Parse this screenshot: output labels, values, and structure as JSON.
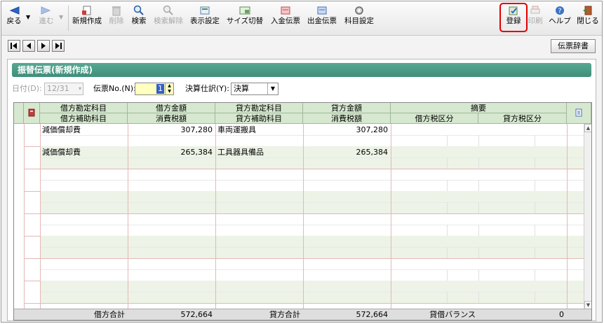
{
  "toolbar": {
    "back": "戻る",
    "forward": "進む",
    "new": "新規作成",
    "delete": "削除",
    "search": "検索",
    "search_clear": "検索解除",
    "display_settings": "表示設定",
    "size_toggle": "サイズ切替",
    "deposit_slip": "入金伝票",
    "withdrawal_slip": "出金伝票",
    "account_settings": "科目設定",
    "register": "登録",
    "print": "印刷",
    "help": "ヘルプ",
    "close": "閉じる"
  },
  "nav": {
    "dictionary_button": "伝票辞書"
  },
  "panel_title": "振替伝票(新規作成)",
  "form": {
    "date_label": "日付(D):",
    "date_value": "12/31",
    "slip_no_label": "伝票No.(N):",
    "slip_no_value": "1",
    "closing_label": "決算仕訳(Y):",
    "closing_value": "決算"
  },
  "grid": {
    "headers_top": [
      "借方勘定科目",
      "借方金額",
      "貸方勘定科目",
      "貸方金額",
      "摘要"
    ],
    "headers_bottom": [
      "借方補助科目",
      "消費税額",
      "貸方補助科目",
      "消費税額",
      "借方税区分",
      "貸方税区分"
    ],
    "rows": [
      {
        "debit_account": "減価償却費",
        "debit_amount": "307,280",
        "credit_account": "車両運搬具",
        "credit_amount": "307,280"
      },
      {
        "debit_account": "減価償却費",
        "debit_amount": "265,384",
        "credit_account": "工具器具備品",
        "credit_amount": "265,384"
      }
    ],
    "footer": {
      "debit_total_label": "借方合計",
      "debit_total": "572,664",
      "credit_total_label": "貸方合計",
      "credit_total": "572,664",
      "balance_label": "貸借バランス",
      "balance": "0"
    }
  },
  "colors": {
    "title_bar": "#4a9b85",
    "header_bg": "#d6e8cf",
    "highlight": "#e00000",
    "slip_no_bg": "#ffffc0"
  }
}
